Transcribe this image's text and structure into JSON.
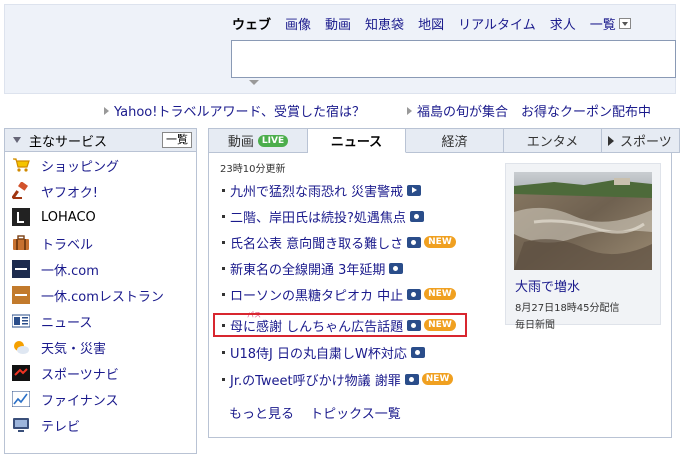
{
  "search": {
    "tabs": [
      "ウェブ",
      "画像",
      "動画",
      "知恵袋",
      "地図",
      "リアルタイム",
      "求人"
    ],
    "more_label": "一覧"
  },
  "promos": [
    {
      "text": "Yahoo!トラベルアワード、受賞した宿は？"
    },
    {
      "text": "福島の旬が集合　お得なクーポン配布中"
    }
  ],
  "services": {
    "title": "主なサービス",
    "list_button": "一覧",
    "items": [
      {
        "label": "ショッピング",
        "icon": "shopping-cart-icon"
      },
      {
        "label": "ヤフオク!",
        "icon": "auction-gavel-icon"
      },
      {
        "label": "LOHACO",
        "icon": "lohaco-logo-icon"
      },
      {
        "label": "トラベル",
        "icon": "suitcase-icon"
      },
      {
        "label": "一休.com",
        "icon": "ikkyu-icon"
      },
      {
        "label": "一休.comレストラン",
        "icon": "ikkyu-restaurant-icon"
      },
      {
        "label": "ニュース",
        "icon": "news-icon"
      },
      {
        "label": "天気・災害",
        "icon": "weather-icon"
      },
      {
        "label": "スポーツナビ",
        "icon": "sportsnavi-icon"
      },
      {
        "label": "ファイナンス",
        "icon": "finance-chart-icon"
      },
      {
        "label": "テレビ",
        "icon": "tv-icon"
      }
    ]
  },
  "news": {
    "tabs": [
      {
        "label": "動画",
        "badge": "LIVE"
      },
      {
        "label": "ニュース"
      },
      {
        "label": "経済"
      },
      {
        "label": "エンタメ"
      },
      {
        "label": "スポーツ"
      }
    ],
    "updated": "23時10分更新",
    "ruby": "パス",
    "headlines": [
      {
        "text": "九州で猛烈な雨恐れ 災害警戒",
        "media": "video",
        "new": false
      },
      {
        "text": "二階、岸田氏は続投?処遇焦点",
        "media": "photo",
        "new": false
      },
      {
        "text": "氏名公表 意向聞き取る難しさ",
        "media": "photo",
        "new": true
      },
      {
        "text": "新東名の全線開通 3年延期",
        "media": "photo",
        "new": false
      },
      {
        "text": "ローソンの黒糖タピオカ 中止",
        "media": "photo",
        "new": true
      },
      {
        "text": "母に感謝 しんちゃん広告話題",
        "media": "photo",
        "new": true
      },
      {
        "text": "U18侍J 日の丸自粛しW杯対応",
        "media": "photo",
        "new": false
      },
      {
        "text": "Jr.のTweet呼びかけ物議 謝罪",
        "media": "photo",
        "new": true
      }
    ],
    "new_label": "NEW",
    "more_links": [
      "もっと見る",
      "トピックス一覧"
    ],
    "photo": {
      "title": "大雨で増水",
      "date": "8月27日18時45分配信",
      "source": "毎日新聞"
    }
  },
  "colors": {
    "link": "#1a1a8c",
    "live_badge": "#4cae4c",
    "new_badge": "#f0a020",
    "highlight_border": "#d8262f"
  }
}
